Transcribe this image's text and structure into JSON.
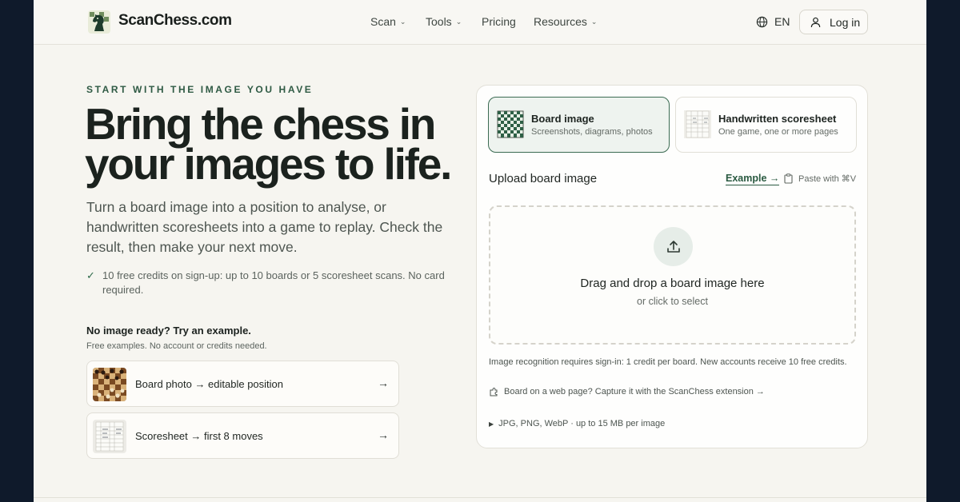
{
  "brand": {
    "name": "ScanChess.com"
  },
  "nav": {
    "items": [
      {
        "label": "Scan",
        "has_dropdown": true
      },
      {
        "label": "Tools",
        "has_dropdown": true
      },
      {
        "label": "Pricing",
        "has_dropdown": false
      },
      {
        "label": "Resources",
        "has_dropdown": true
      }
    ],
    "language": "EN",
    "login_label": "Log in"
  },
  "hero": {
    "eyebrow": "START WITH THE IMAGE YOU HAVE",
    "headline": "Bring the chess in your images to life.",
    "lead": "Turn a board image into a position to analyse, or handwritten scoresheets into a game to replay. Check the result, then make your next move.",
    "benefit": "10 free credits on sign-up: up to 10 boards or 5 scoresheet scans. No card required."
  },
  "examples": {
    "title": "No image ready? Try an example.",
    "subtitle": "Free examples. No account or credits needed.",
    "items": [
      {
        "label": "Board photo → editable position"
      },
      {
        "label": "Scoresheet → first 8 moves"
      }
    ]
  },
  "uploader": {
    "modes": [
      {
        "title": "Board image",
        "subtitle": "Screenshots, diagrams, photos",
        "selected": true
      },
      {
        "title": "Handwritten scoresheet",
        "subtitle": "One game, one or more pages",
        "selected": false
      }
    ],
    "title": "Upload board image",
    "example_link": "Example →",
    "paste_hint": "Paste with ⌘V",
    "drop_main": "Drag and drop a board image here",
    "drop_sub": "or click to select",
    "credit_note": "Image recognition requires sign-in: 1 credit per board. New accounts receive 10 free credits.",
    "extension_link": "Board on a web page? Capture it with the ScanChess extension →",
    "formats": "JPG, PNG, WebP · up to 15 MB per image"
  },
  "icons": {
    "logo": "knight-logo-icon",
    "language": "globe-icon",
    "login": "user-icon",
    "benefit": "check-icon",
    "upload": "upload-icon",
    "paste": "clipboard-icon",
    "extension": "puzzle-icon"
  },
  "colors": {
    "accent": "#2f5a44",
    "selected_border": "#3b6b52",
    "selected_bg": "#eef3ef",
    "page_bg": "#f6f5f0",
    "frame_bg": "#0f1a2b"
  }
}
